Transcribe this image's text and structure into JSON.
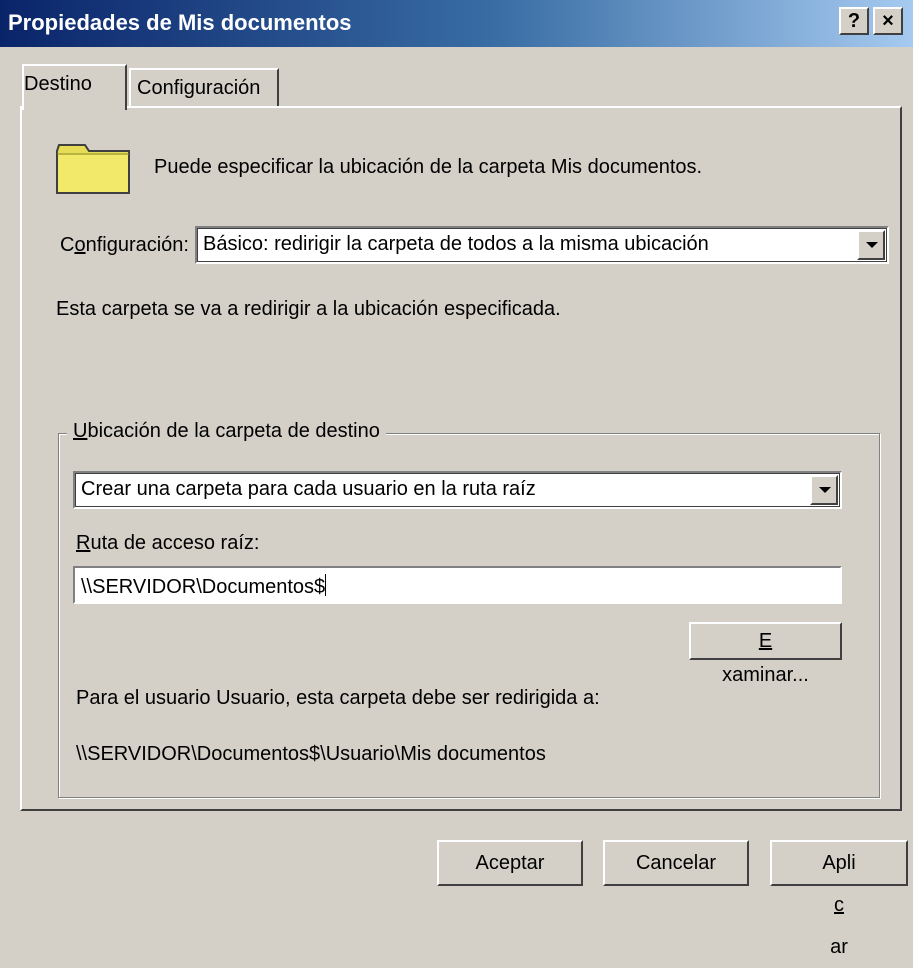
{
  "window": {
    "title": "Propiedades de Mis documentos",
    "help_button": "?",
    "close_button": "×"
  },
  "tabs": [
    {
      "label": "Destino",
      "active": true
    },
    {
      "label": "Configuración",
      "active": false
    }
  ],
  "intro": {
    "icon": "folder-icon",
    "text": "Puede especificar la ubicación de la carpeta Mis documentos."
  },
  "setting": {
    "label_prefix": "C",
    "label_accel": "o",
    "label_rest": "nfiguración:",
    "value": "Básico: redirigir la carpeta de todos a la misma ubicación"
  },
  "description": "Esta carpeta se va a redirigir a la ubicación especificada.",
  "target_group": {
    "legend_accel": "U",
    "legend_rest": "bicación de la carpeta de destino",
    "option_value": "Crear una carpeta para cada usuario en la ruta raíz",
    "root_label_accel": "R",
    "root_label_rest": "uta de acceso raíz:",
    "root_path": "\\\\SERVIDOR\\Documentos$",
    "browse_accel": "E",
    "browse_rest": "xaminar...",
    "redirect_note": "Para el usuario Usuario, esta carpeta debe ser redirigida a:",
    "redirect_path": "\\\\SERVIDOR\\Documentos$\\Usuario\\Mis documentos"
  },
  "buttons": {
    "ok": "Aceptar",
    "cancel": "Cancelar",
    "apply_prefix": "Apli",
    "apply_accel": "c",
    "apply_rest": "ar"
  },
  "colors": {
    "title_bar_start": "#0a246a",
    "title_bar_end": "#a6caf0",
    "face": "#d4d0c8",
    "folder": "#f2e96b"
  }
}
